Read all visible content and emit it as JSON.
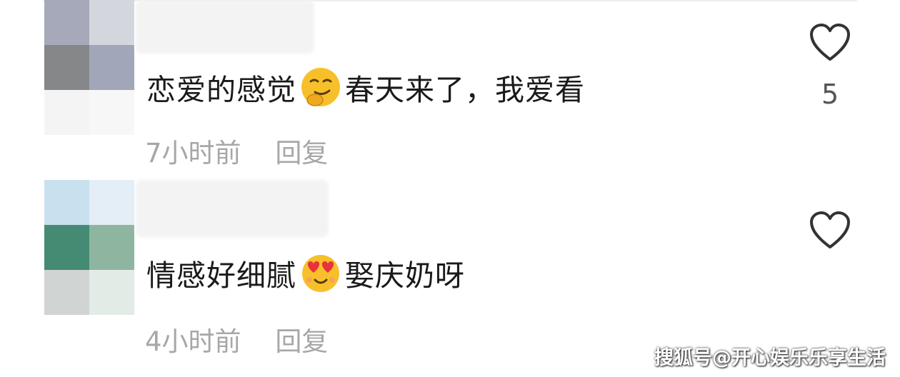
{
  "comments": [
    {
      "text_before_emoji": "恋爱的感觉",
      "emoji": "hugging-smirk-emoji",
      "text_after_emoji": "春天来了，我爱看",
      "time": "7小时前",
      "reply_label": "回复",
      "like_count": "5"
    },
    {
      "text_before_emoji": "情感好细腻",
      "emoji": "heart-eyes-emoji",
      "text_after_emoji": "娶庆奶呀",
      "time": "4小时前",
      "reply_label": "回复",
      "like_count": ""
    }
  ],
  "watermark": "搜狐号@开心娱乐乐享生活",
  "colors": {
    "meta_text": "#a7a7a7",
    "heart_stroke": "#333333"
  }
}
